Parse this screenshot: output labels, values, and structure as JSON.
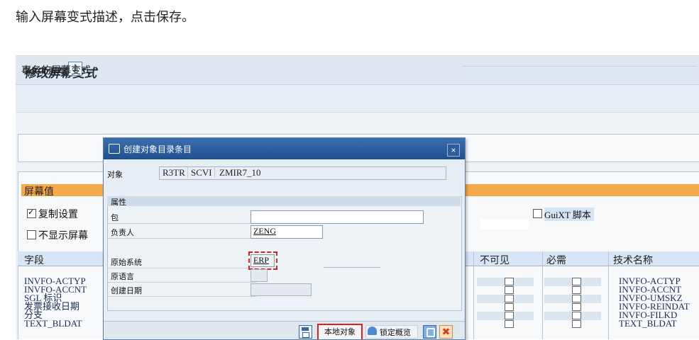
{
  "instruction": "输入屏幕变式描述，点击保存。",
  "sap": {
    "title": "修改屏幕变式",
    "guixt_label": "GuiXT 脚本",
    "info_icon": "i",
    "variant_label": "事务的屏幕变式",
    "screen_values_label": "屏幕值",
    "copy_settings_label": "复制设置",
    "hide_screen_label": "不显示屏幕",
    "guixt_script_label": "GuiXT 脚本",
    "table": {
      "headers": {
        "field": "字段",
        "invisible": "不可见",
        "required": "必需",
        "tech_name": "技术名称"
      },
      "fields": [
        "INVFO-ACTYP",
        "INVFO-ACCNT",
        "SGL 标识",
        "发票接收日期",
        "分支",
        "TEXT_BLDAT"
      ],
      "tech_names": [
        "INVFO-ACTYP",
        "INVFO-ACCNT",
        "INVFO-UMSKZ",
        "INVFO-REINDAT",
        "INVFO-FILKD",
        "TEXT_BLDAT"
      ]
    }
  },
  "dialog": {
    "title": "创建对象目录条目",
    "close_icon": "×",
    "object_label": "对象",
    "object_segments": [
      "R3TR",
      "SCVI",
      "ZMIR7_10"
    ],
    "attributes_label": "属性",
    "package_label": "包",
    "package_value": "",
    "owner_label": "负责人",
    "owner_value": "ZENG",
    "orig_system_label": "原始系统",
    "orig_system_value": "ERP",
    "orig_language_label": "原语言",
    "created_date_label": "创建日期",
    "buttons": {
      "local_object": "本地对象",
      "lock_overview": "锁定概览"
    }
  },
  "colors": {
    "accent_orange": "#f5a94a",
    "highlight_red": "#e02020",
    "dialog_title_blue": "#1f4f8e"
  }
}
